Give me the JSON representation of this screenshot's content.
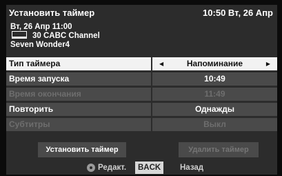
{
  "header": {
    "title": "Установить таймер",
    "clock": "10:50 Вт, 26 Апр"
  },
  "program": {
    "datetime": "Вт, 26 Апр 11:00",
    "channel": "30 CABC Channel",
    "name": "Seven Wonder4"
  },
  "rows": [
    {
      "label": "Тип таймера",
      "value": "Напоминание"
    },
    {
      "label": "Время запуска",
      "value": "10:49"
    },
    {
      "label": "Время окончания",
      "value": "11:49"
    },
    {
      "label": "Повторить",
      "value": "Однажды"
    },
    {
      "label": "Субтитры",
      "value": "Выкл"
    }
  ],
  "buttons": {
    "set": "Установить таймер",
    "delete": "Удалить таймер"
  },
  "footer": {
    "edit": "Редакт.",
    "back_key": "BACK",
    "back_label": "Назад"
  },
  "icons": {
    "arrow_left": "◀",
    "arrow_right": "▶"
  }
}
